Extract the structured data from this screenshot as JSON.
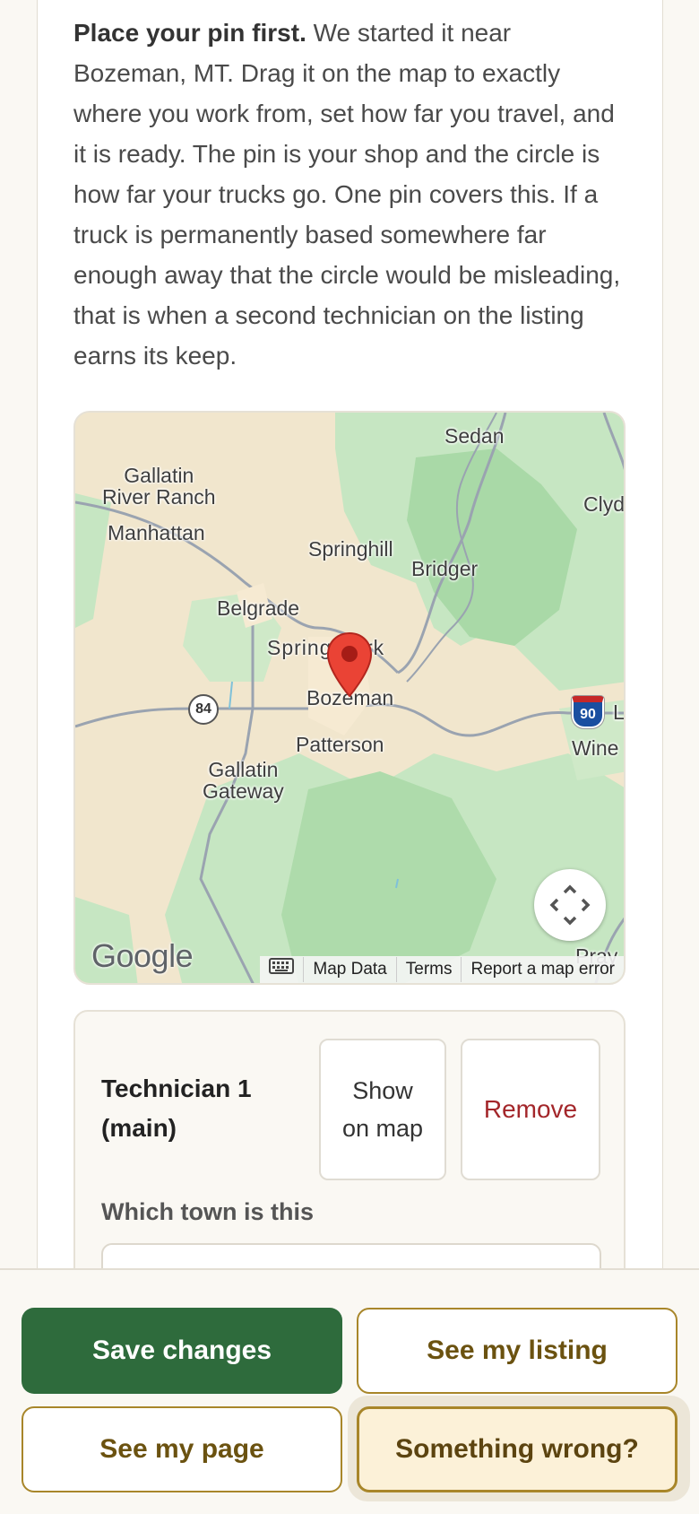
{
  "intro": {
    "bold": "Place your pin first.",
    "text": " We started it near Bozeman, MT. Drag it on the map to exactly where you work from, set how far you travel, and it is ready. The pin is your shop and the circle is how far your trucks go. One pin covers this. If a truck is permanently based somewhere far enough away that the circle would be misleading, that is when a second technician on the listing earns its keep."
  },
  "map": {
    "labels": {
      "sedan": "Sedan",
      "gallatin_river_ranch": "Gallatin\nRiver Ranch",
      "clyde": "Clyd",
      "manhattan": "Manhattan",
      "springhill": "Springhill",
      "bridger": "Bridger",
      "belgrade": "Belgrade",
      "spring_hill_park": "Spring Park",
      "bozeman": "Bozeman",
      "patterson": "Patterson",
      "winec": "Wine",
      "gallatin_gateway": "Gallatin\nGateway",
      "pray": "Pray",
      "highway_84": "84",
      "interstate_90": "90",
      "l_partial": "L"
    },
    "google_logo": "Google",
    "attribution": {
      "map_data": "Map Data",
      "terms": "Terms",
      "report": "Report a map error"
    },
    "icons": {
      "pin": "map-pin-icon",
      "fullscreen": "fullscreen-icon",
      "keyboard": "keyboard-icon"
    },
    "colors": {
      "land": "#f1e6cd",
      "forest": "#c6e6c2",
      "forest_dark": "#a8d8a6",
      "pin": "#e53935"
    }
  },
  "technician": {
    "title": "Technician 1 (main)",
    "show_on_map": "Show on map",
    "remove": "Remove",
    "town_label": "Which town is this",
    "town_value": ""
  },
  "actions": {
    "save": "Save changes",
    "see_listing": "See my listing",
    "see_page": "See my page",
    "something_wrong": "Something wrong?"
  },
  "colors": {
    "primary_green": "#2e6b3c",
    "outline_gold": "#a8862a",
    "remove_red": "#a3262a"
  }
}
